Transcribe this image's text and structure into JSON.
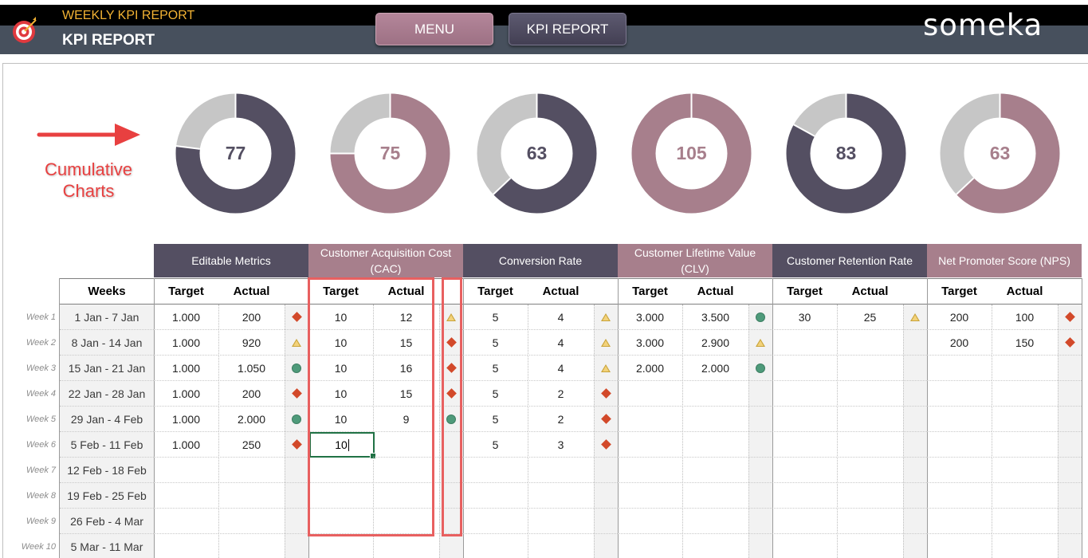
{
  "header": {
    "subtitle": "WEEKLY KPI REPORT",
    "title": "KPI REPORT",
    "menu_button": "MENU",
    "kpi_button": "KPI REPORT",
    "brand": "someka"
  },
  "annotation": {
    "label_line1": "Cumulative",
    "label_line2": "Charts"
  },
  "colors": {
    "dark": "#544f62",
    "mauve": "#a77f8c",
    "gray": "#c6c6c6",
    "header_dark": "#47505d",
    "accent_yellow": "#f2b233",
    "highlight_red": "#e86060"
  },
  "donuts": [
    {
      "value": "77",
      "fraction": 0.77,
      "color": "dark"
    },
    {
      "value": "75",
      "fraction": 0.75,
      "color": "mauve"
    },
    {
      "value": "63",
      "fraction": 0.63,
      "color": "dark"
    },
    {
      "value": "105",
      "fraction": 1.0,
      "color": "mauve"
    },
    {
      "value": "83",
      "fraction": 0.83,
      "color": "dark"
    },
    {
      "value": "63",
      "fraction": 0.63,
      "color": "mauve"
    }
  ],
  "table": {
    "weeks_header": "Weeks",
    "target_label": "Target",
    "actual_label": "Actual",
    "kpis": [
      {
        "name": "Editable Metrics",
        "color": "dark"
      },
      {
        "name": "Customer Acquisition Cost (CAC)",
        "color": "mauve"
      },
      {
        "name": "Conversion Rate",
        "color": "dark"
      },
      {
        "name": "Customer Lifetime Value (CLV)",
        "color": "mauve"
      },
      {
        "name": "Customer Retention Rate",
        "color": "dark"
      },
      {
        "name": "Net Promoter Score (NPS)",
        "color": "mauve"
      }
    ],
    "weeks": [
      {
        "label": "Week 1",
        "dates": "1 Jan - 7 Jan"
      },
      {
        "label": "Week 2",
        "dates": "8 Jan - 14 Jan"
      },
      {
        "label": "Week 3",
        "dates": "15 Jan - 21 Jan"
      },
      {
        "label": "Week 4",
        "dates": "22 Jan - 28 Jan"
      },
      {
        "label": "Week 5",
        "dates": "29 Jan - 4 Feb"
      },
      {
        "label": "Week 6",
        "dates": "5 Feb - 11 Feb"
      },
      {
        "label": "Week 7",
        "dates": "12 Feb - 18 Feb"
      },
      {
        "label": "Week 8",
        "dates": "19 Feb - 25 Feb"
      },
      {
        "label": "Week 9",
        "dates": "26 Feb - 4 Mar"
      },
      {
        "label": "Week 10",
        "dates": "5 Mar - 11 Mar"
      }
    ],
    "values": [
      [
        [
          "1.000",
          "200",
          "diamond"
        ],
        [
          "10",
          "12",
          "triangle"
        ],
        [
          "5",
          "4",
          "triangle"
        ],
        [
          "3.000",
          "3.500",
          "circle"
        ],
        [
          "30",
          "25",
          "triangle"
        ],
        [
          "200",
          "100",
          "diamond"
        ]
      ],
      [
        [
          "1.000",
          "920",
          "triangle"
        ],
        [
          "10",
          "15",
          "diamond"
        ],
        [
          "5",
          "4",
          "triangle"
        ],
        [
          "3.000",
          "2.900",
          "triangle"
        ],
        [
          "",
          "",
          ""
        ],
        [
          "200",
          "150",
          "diamond"
        ]
      ],
      [
        [
          "1.000",
          "1.050",
          "circle"
        ],
        [
          "10",
          "16",
          "diamond"
        ],
        [
          "5",
          "4",
          "triangle"
        ],
        [
          "2.000",
          "2.000",
          "circle"
        ],
        [
          "",
          "",
          ""
        ],
        [
          "",
          "",
          ""
        ]
      ],
      [
        [
          "1.000",
          "200",
          "diamond"
        ],
        [
          "10",
          "15",
          "diamond"
        ],
        [
          "5",
          "2",
          "diamond"
        ],
        [
          "",
          "",
          ""
        ],
        [
          "",
          "",
          ""
        ],
        [
          "",
          "",
          ""
        ]
      ],
      [
        [
          "1.000",
          "2.000",
          "circle"
        ],
        [
          "10",
          "9",
          "circle"
        ],
        [
          "5",
          "2",
          "diamond"
        ],
        [
          "",
          "",
          ""
        ],
        [
          "",
          "",
          ""
        ],
        [
          "",
          "",
          ""
        ]
      ],
      [
        [
          "1.000",
          "250",
          "diamond"
        ],
        [
          "10",
          "",
          ""
        ],
        [
          "5",
          "3",
          "diamond"
        ],
        [
          "",
          "",
          ""
        ],
        [
          "",
          "",
          ""
        ],
        [
          "",
          "",
          ""
        ]
      ],
      [
        [
          "",
          "",
          ""
        ],
        [
          "",
          "",
          ""
        ],
        [
          "",
          "",
          ""
        ],
        [
          "",
          "",
          ""
        ],
        [
          "",
          "",
          ""
        ],
        [
          "",
          "",
          ""
        ]
      ],
      [
        [
          "",
          "",
          ""
        ],
        [
          "",
          "",
          ""
        ],
        [
          "",
          "",
          ""
        ],
        [
          "",
          "",
          ""
        ],
        [
          "",
          "",
          ""
        ],
        [
          "",
          "",
          ""
        ]
      ],
      [
        [
          "",
          "",
          ""
        ],
        [
          "",
          "",
          ""
        ],
        [
          "",
          "",
          ""
        ],
        [
          "",
          "",
          ""
        ],
        [
          "",
          "",
          ""
        ],
        [
          "",
          "",
          ""
        ]
      ],
      [
        [
          "",
          "",
          ""
        ],
        [
          "",
          "",
          ""
        ],
        [
          "",
          "",
          ""
        ],
        [
          "",
          "",
          ""
        ],
        [
          "",
          "",
          ""
        ],
        [
          "",
          "",
          ""
        ]
      ]
    ]
  }
}
